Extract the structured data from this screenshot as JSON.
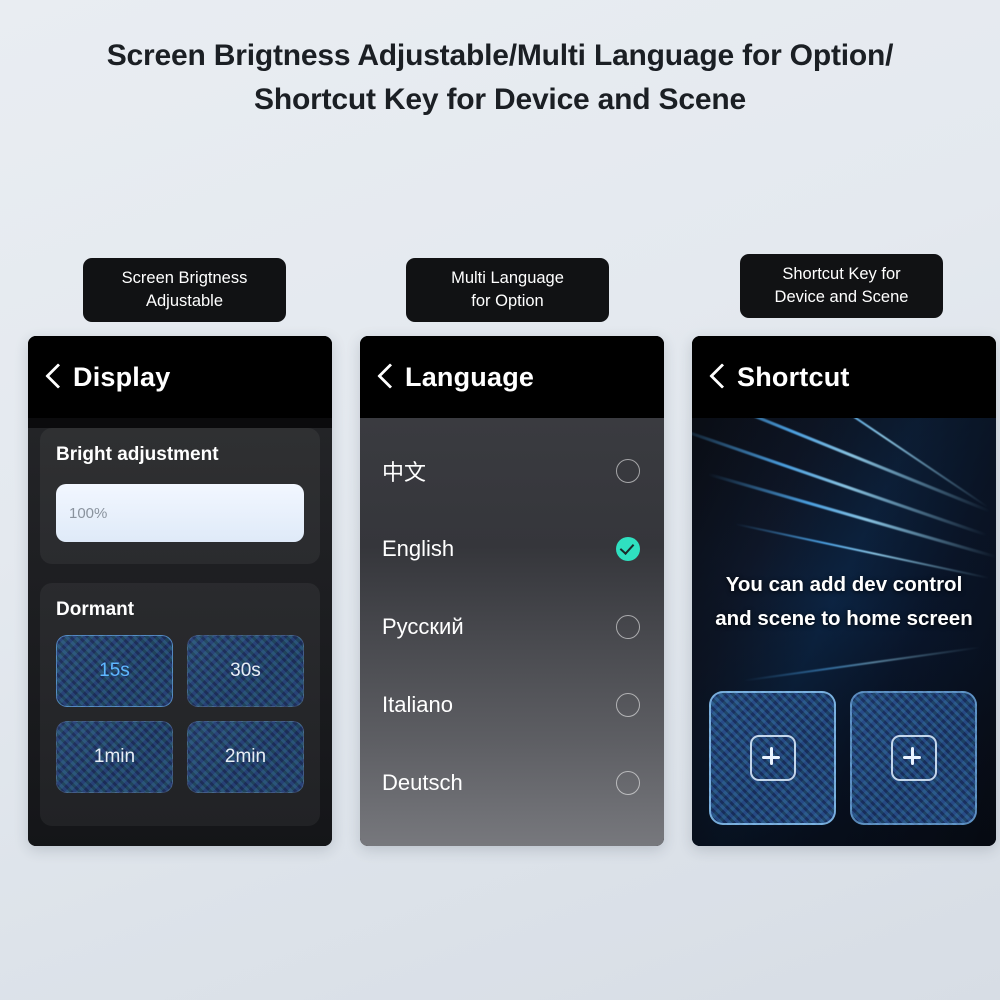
{
  "headline": {
    "line1": "Screen Brigtness Adjustable/Multi Language for Option/",
    "line2": "Shortcut Key for Device and Scene"
  },
  "captions": [
    {
      "line1": "Screen Brigtness",
      "line2": "Adjustable"
    },
    {
      "line1": "Multi Language",
      "line2": "for Option"
    },
    {
      "line1": "Shortcut Key for",
      "line2": "Device and Scene"
    }
  ],
  "panels": {
    "display": {
      "title": "Display",
      "back_icon": "back-chevron-icon",
      "brightness_label": "Bright adjustment",
      "brightness_value": "100%",
      "dormant_label": "Dormant",
      "dormant_options": [
        {
          "label": "15s",
          "active": true
        },
        {
          "label": "30s",
          "active": false
        },
        {
          "label": "1min",
          "active": false
        },
        {
          "label": "2min",
          "active": false
        }
      ]
    },
    "language": {
      "title": "Language",
      "back_icon": "back-chevron-icon",
      "options": [
        {
          "label": "中文",
          "selected": false
        },
        {
          "label": "English",
          "selected": true
        },
        {
          "label": "Русский",
          "selected": false
        },
        {
          "label": "Italiano",
          "selected": false
        },
        {
          "label": "Deutsch",
          "selected": false
        }
      ]
    },
    "shortcut": {
      "title": "Shortcut",
      "back_icon": "back-chevron-icon",
      "hint_line1": "You can add dev control",
      "hint_line2": "and scene to home screen",
      "tiles": [
        {
          "icon": "plus-icon"
        },
        {
          "icon": "plus-icon"
        }
      ]
    }
  },
  "colors": {
    "accent": "#2fe0c0",
    "active_chip_text": "#5eb8ff",
    "panel_header": "#000000",
    "caption_bg": "#111214"
  }
}
